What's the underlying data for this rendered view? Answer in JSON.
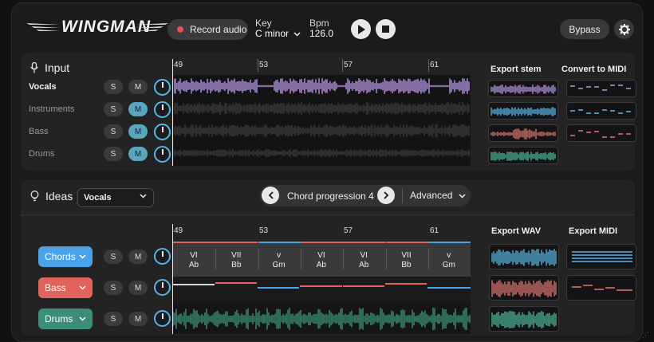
{
  "header": {
    "logo": "WINGMAN",
    "record_label": "Record audio",
    "key_label": "Key",
    "key_value": "C minor",
    "bpm_label": "Bpm",
    "bpm_value": "126.0",
    "bypass_label": "Bypass"
  },
  "input": {
    "title": "Input",
    "bars": [
      "49",
      "53",
      "57",
      "61"
    ],
    "tracks": [
      {
        "name": "Vocals",
        "solo": "S",
        "mute": "M",
        "muted": false,
        "color": "#b497e2"
      },
      {
        "name": "Instruments",
        "solo": "S",
        "mute": "M",
        "muted": true,
        "color": "#3a3a3a"
      },
      {
        "name": "Bass",
        "solo": "S",
        "mute": "M",
        "muted": true,
        "color": "#3a3a3a"
      },
      {
        "name": "Drums",
        "solo": "S",
        "mute": "M",
        "muted": true,
        "color": "#3a3a3a"
      }
    ],
    "export_stem_label": "Export stem",
    "convert_midi_label": "Convert to MIDI"
  },
  "ideas": {
    "title": "Ideas",
    "source": "Vocals",
    "progression": "Chord progression 4",
    "advanced_label": "Advanced",
    "bars": [
      "49",
      "53",
      "57",
      "61"
    ],
    "chords": [
      {
        "roman": "VI",
        "name": "Ab"
      },
      {
        "roman": "VII",
        "name": "Bb"
      },
      {
        "roman": "v",
        "name": "Gm"
      },
      {
        "roman": "VI",
        "name": "Ab"
      },
      {
        "roman": "VI",
        "name": "Ab"
      },
      {
        "roman": "VII",
        "name": "Bb"
      },
      {
        "roman": "v",
        "name": "Gm"
      }
    ],
    "tracks": [
      {
        "name": "Chords",
        "solo": "S",
        "mute": "M",
        "color": "#4aa3e8"
      },
      {
        "name": "Bass",
        "solo": "S",
        "mute": "M",
        "color": "#e0645c"
      },
      {
        "name": "Drums",
        "solo": "S",
        "mute": "M",
        "color": "#3d8e79"
      }
    ],
    "export_wav_label": "Export WAV",
    "export_midi_label": "Export MIDI"
  },
  "colors": {
    "accent_blue": "#55b4e8",
    "vocals": "#b497e2",
    "stem_blue": "#5bb7e6",
    "stem_red": "#e0776f",
    "stem_green": "#4fb79b"
  }
}
